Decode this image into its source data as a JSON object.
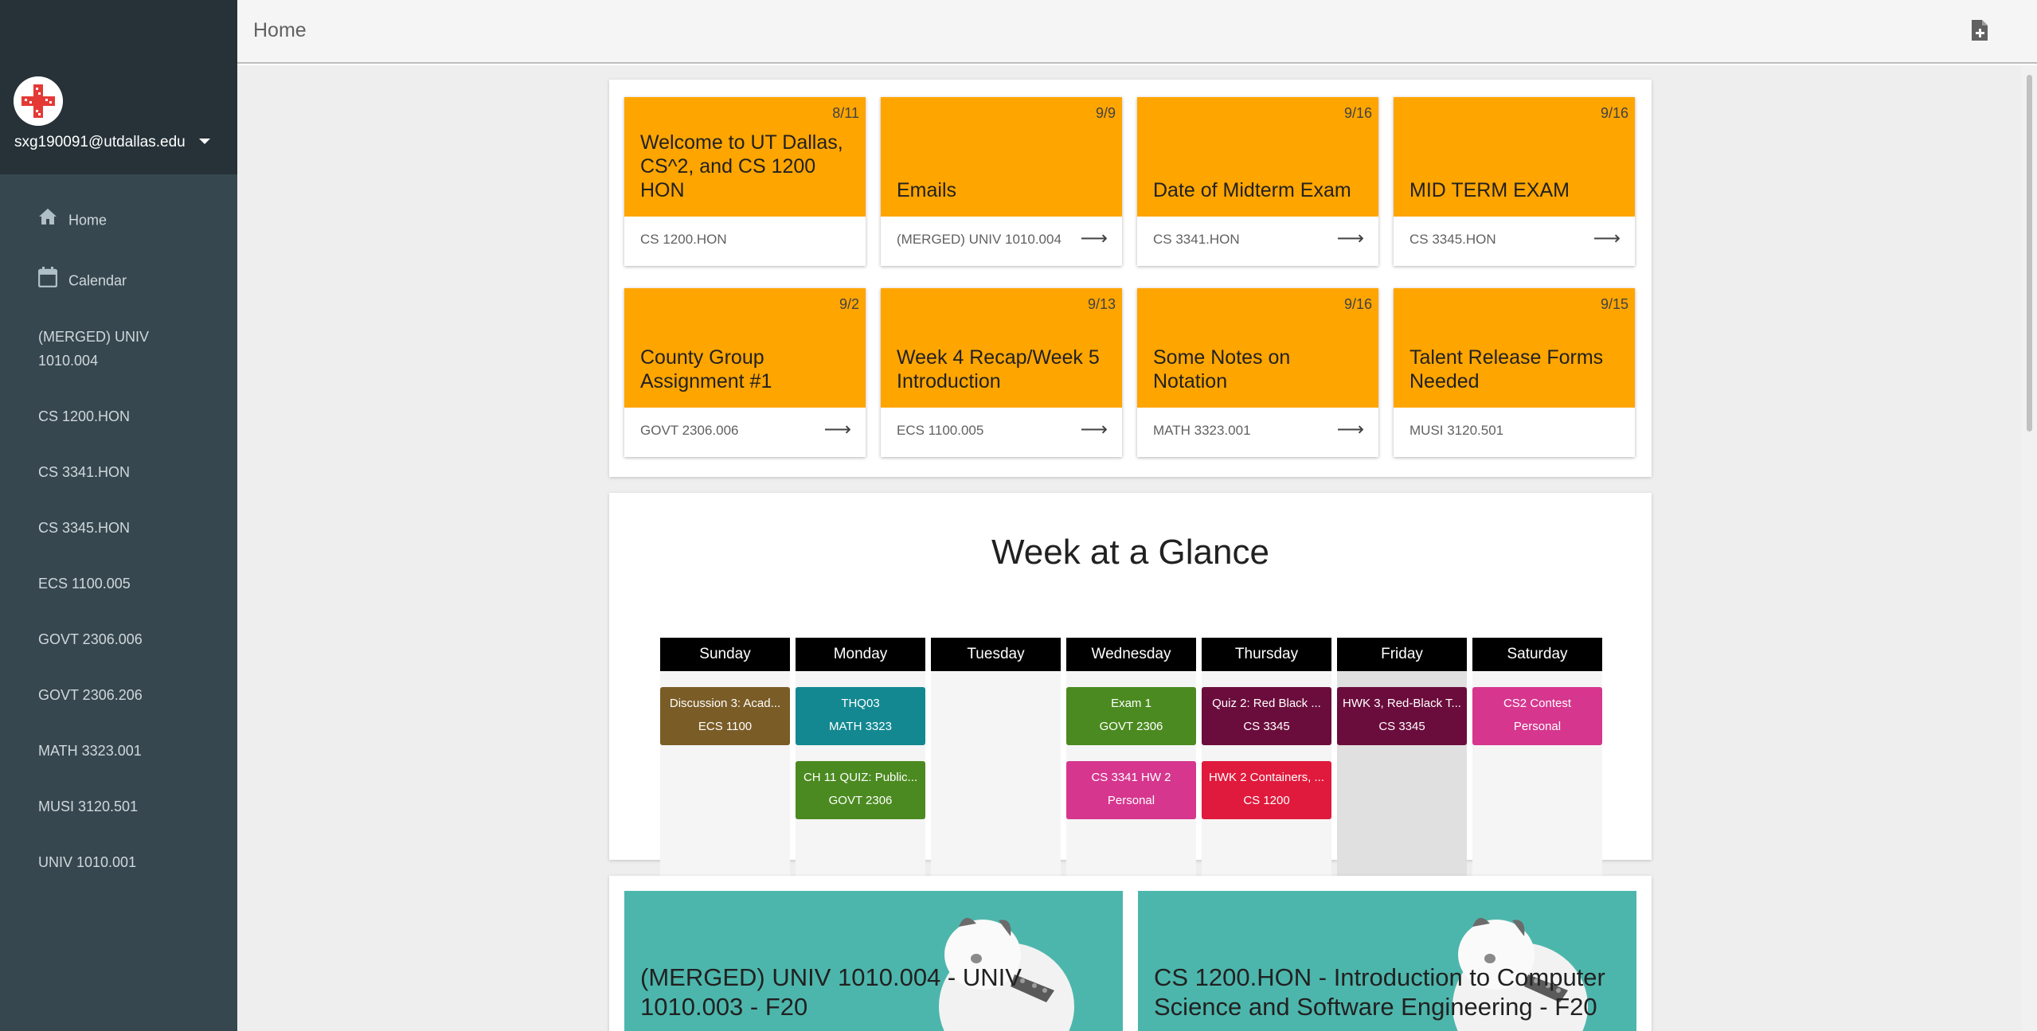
{
  "user": {
    "email": "sxg190091@utdallas.edu"
  },
  "sidebar": {
    "home_label": "Home",
    "calendar_label": "Calendar",
    "courses": [
      "(MERGED) UNIV 1010.004",
      "CS 1200.HON",
      "CS 3341.HON",
      "CS 3345.HON",
      "ECS 1100.005",
      "GOVT 2306.006",
      "GOVT 2306.206",
      "MATH 3323.001",
      "MUSI 3120.501",
      "UNIV 1010.001"
    ]
  },
  "header": {
    "title": "Home"
  },
  "announcements": [
    {
      "date": "8/11",
      "title": "Welcome to UT Dallas, CS^2, and CS 1200 HON",
      "course": "CS 1200.HON",
      "arrow": ""
    },
    {
      "date": "9/9",
      "title": "Emails",
      "course": "(MERGED) UNIV 1010.004",
      "arrow": "⟶"
    },
    {
      "date": "9/16",
      "title": "Date of Midterm Exam",
      "course": "CS 3341.HON",
      "arrow": "⟶"
    },
    {
      "date": "9/16",
      "title": "MID TERM EXAM",
      "course": "CS 3345.HON",
      "arrow": "⟶"
    },
    {
      "date": "9/2",
      "title": "County Group Assignment #1",
      "course": "GOVT 2306.006",
      "arrow": "⟶"
    },
    {
      "date": "9/13",
      "title": "Week 4 Recap/Week 5 Introduction",
      "course": "ECS 1100.005",
      "arrow": "⟶"
    },
    {
      "date": "9/16",
      "title": "Some Notes on Notation",
      "course": "MATH 3323.001",
      "arrow": "⟶"
    },
    {
      "date": "9/15",
      "title": "Talent Release Forms Needed",
      "course": "MUSI 3120.501",
      "arrow": ""
    }
  ],
  "week": {
    "title": "Week at a Glance",
    "days": [
      "Sunday",
      "Monday",
      "Tuesday",
      "Wednesday",
      "Thursday",
      "Friday",
      "Saturday"
    ],
    "events": {
      "sunday": [
        {
          "title": "Discussion 3: Acad...",
          "course": "ECS 1100",
          "color": "#7a5c27"
        }
      ],
      "monday": [
        {
          "title": "THQ03",
          "course": "MATH 3323",
          "color": "#138891"
        },
        {
          "title": "CH 11 QUIZ: Public...",
          "course": "GOVT 2306",
          "color": "#4b8a20"
        }
      ],
      "wednesday": [
        {
          "title": "Exam 1",
          "course": "GOVT 2306",
          "color": "#4b8a20"
        },
        {
          "title": "CS 3341 HW 2",
          "course": "Personal",
          "color": "#d6368e"
        }
      ],
      "thursday": [
        {
          "title": "Quiz 2: Red Black ...",
          "course": "CS 3345",
          "color": "#6b0d3c"
        },
        {
          "title": "HWK 2 Containers, ...",
          "course": "CS 1200",
          "color": "#e01a3d"
        }
      ],
      "friday": [
        {
          "title": "HWK 3, Red-Black T...",
          "course": "CS 3345",
          "color": "#6b0d3c"
        }
      ],
      "saturday": [
        {
          "title": "CS2 Contest",
          "course": "Personal",
          "color": "#d6368e"
        }
      ]
    }
  },
  "course_cards": [
    {
      "title": "(MERGED) UNIV 1010.004 - UNIV 1010.003 - F20"
    },
    {
      "title": "CS 1200.HON - Introduction to Computer Science and Software Engineering - F20"
    }
  ],
  "colors": {
    "announcement": "#ffa500",
    "course_card": "#4db6ac",
    "sidebar": "#37474f",
    "sidebar_top": "#263238"
  }
}
